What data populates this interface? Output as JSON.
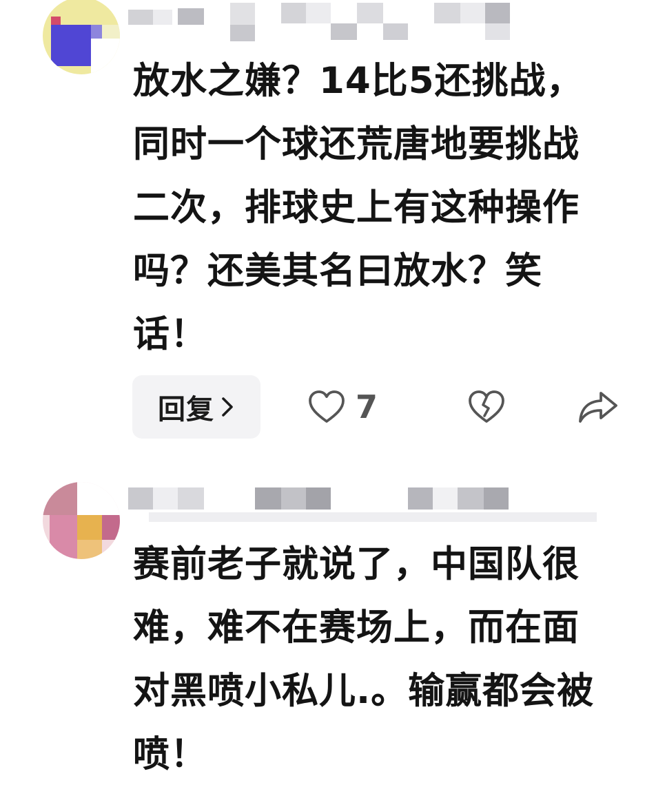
{
  "comments": [
    {
      "author": "",
      "text": "放水之嫌？14比5还挑战，同时一个球还荒唐地要挑战二次，排球史上有这种操作吗？还美其名曰放水？笑话！",
      "actions": {
        "reply_label": "回复",
        "like_count": "7"
      },
      "icons": {
        "reply": "chevron-right-icon",
        "like": "heart-outline-icon",
        "dislike": "broken-heart-icon",
        "share": "share-arrow-icon"
      }
    },
    {
      "author": "",
      "text": "赛前老子就说了，中国队很难，难不在赛场上，而在面对黑喷小私儿.。输赢都会被喷！"
    }
  ],
  "colors": {
    "text": "#141414",
    "icon": "#555555",
    "reply_bg": "#f3f3f5",
    "avatar1": [
      "#efe9a0",
      "#5046d4",
      "#e3e3e9",
      "#c8a4b4"
    ],
    "avatar2": [
      "#d98aa8",
      "#e7b24f",
      "#f2d9de",
      "#c36a8c"
    ]
  }
}
